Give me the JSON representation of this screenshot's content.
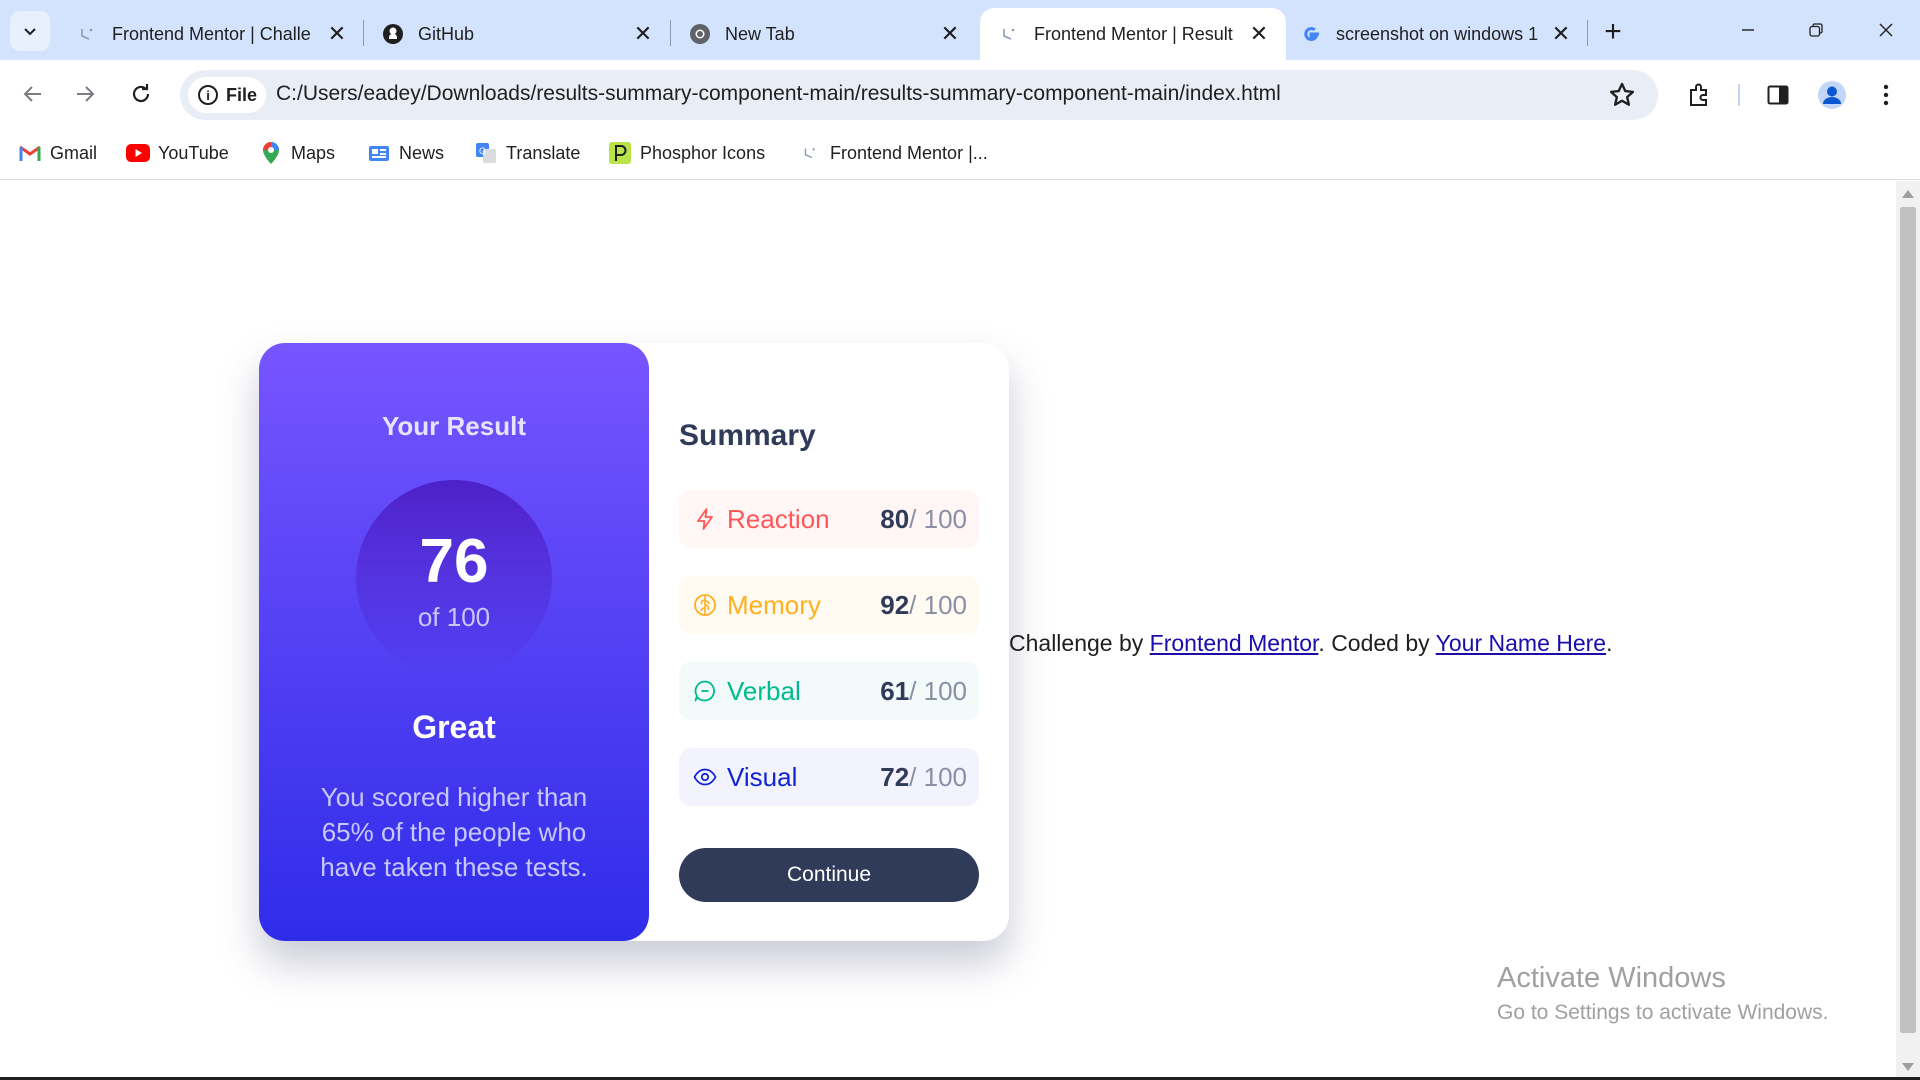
{
  "browser": {
    "tabs": [
      {
        "title": "Frontend Mentor | Challe",
        "favicon": "frontend-mentor-icon",
        "active": false
      },
      {
        "title": "GitHub",
        "favicon": "github-icon",
        "active": false
      },
      {
        "title": "New Tab",
        "favicon": "chrome-icon",
        "active": false
      },
      {
        "title": "Frontend Mentor | Result",
        "favicon": "frontend-mentor-icon",
        "active": true
      },
      {
        "title": "screenshot on windows 1",
        "favicon": "google-icon",
        "active": false
      }
    ],
    "chip_label": "File",
    "url": "C:/Users/eadey/Downloads/results-summary-component-main/results-summary-component-main/index.html",
    "bookmarks": [
      {
        "label": "Gmail",
        "icon": "gmail-icon"
      },
      {
        "label": "YouTube",
        "icon": "youtube-icon"
      },
      {
        "label": "Maps",
        "icon": "maps-icon"
      },
      {
        "label": "News",
        "icon": "news-icon"
      },
      {
        "label": "Translate",
        "icon": "translate-icon"
      },
      {
        "label": "Phosphor Icons",
        "icon": "phosphor-icon"
      },
      {
        "label": "Frontend Mentor |...",
        "icon": "frontend-mentor-icon"
      }
    ]
  },
  "result": {
    "title": "Your Result",
    "score": "76",
    "of_label": "of 100",
    "grade": "Great",
    "description": "You scored higher than 65% of the people who have taken these tests."
  },
  "summary": {
    "title": "Summary",
    "items": [
      {
        "label": "Reaction",
        "score": "80",
        "total": " / 100",
        "color": "#ff5757",
        "bg": "#fff6f5",
        "icon": "lightning-icon"
      },
      {
        "label": "Memory",
        "score": "92",
        "total": " / 100",
        "color": "#ffb01f",
        "bg": "#fffbf2",
        "icon": "brain-icon"
      },
      {
        "label": "Verbal",
        "score": "61",
        "total": " / 100",
        "color": "#00bb8f",
        "bg": "#f2fbfa",
        "icon": "chat-bubble-icon"
      },
      {
        "label": "Visual",
        "score": "72",
        "total": " / 100",
        "color": "#1125d6",
        "bg": "#f3f3fd",
        "icon": "eye-icon"
      }
    ],
    "button": "Continue"
  },
  "attribution": {
    "prefix": "Challenge by ",
    "link1": "Frontend Mentor",
    "middle": ". Coded by ",
    "link2": "Your Name Here",
    "suffix": "."
  },
  "watermark": {
    "line1": "Activate Windows",
    "line2": "Go to Settings to activate Windows."
  }
}
